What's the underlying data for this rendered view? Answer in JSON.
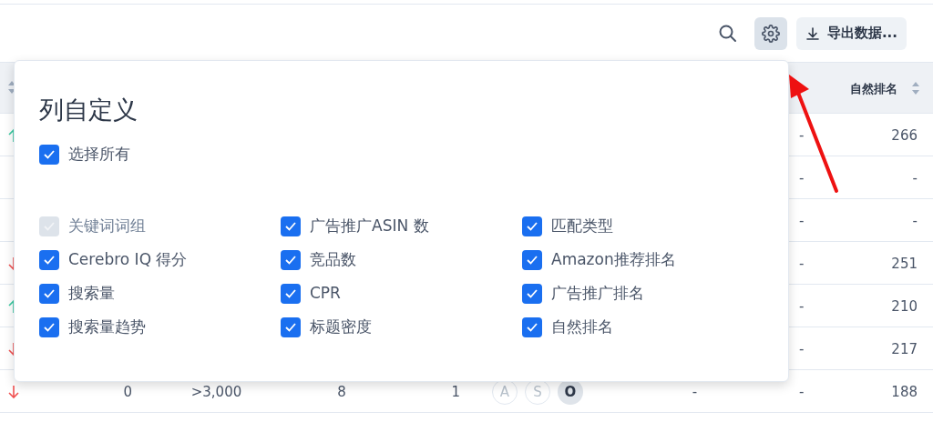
{
  "toolbar": {
    "export_button": "导出数据..."
  },
  "table": {
    "header": {
      "natural_rank": "自然排名"
    },
    "rows": [
      {
        "kind": "up",
        "column_8": "-",
        "natural_rank": "266"
      },
      {
        "column_8": "-",
        "natural_rank": "-"
      },
      {
        "column_8": "-",
        "natural_rank": "-"
      },
      {
        "kind": "down",
        "column_8": "-",
        "natural_rank": "251"
      },
      {
        "kind": "up",
        "column_8": "-",
        "natural_rank": "210"
      },
      {
        "kind": "down",
        "column_8": "-",
        "natural_rank": "217"
      },
      {
        "kind": "down",
        "column_2": "0",
        "column_3": ">3,000",
        "column_4": "8",
        "column_5": "1",
        "badges": [
          {
            "label": "A",
            "selected": false
          },
          {
            "label": "S",
            "selected": false
          },
          {
            "label": "O",
            "selected": true
          }
        ],
        "column_7": "-",
        "column_8": "-",
        "natural_rank": "188"
      }
    ]
  },
  "popup": {
    "title": "列自定义",
    "select_all": {
      "label": "选择所有",
      "checked": true,
      "disabled": false
    },
    "columns": [
      [
        {
          "label": "关键词词组",
          "checked": true,
          "disabled": true
        },
        {
          "label": "Cerebro IQ 得分",
          "checked": true,
          "disabled": false
        },
        {
          "label": "搜索量",
          "checked": true,
          "disabled": false
        },
        {
          "label": "搜索量趋势",
          "checked": true,
          "disabled": false
        }
      ],
      [
        {
          "label": "广告推广ASIN 数",
          "checked": true,
          "disabled": false
        },
        {
          "label": "竞品数",
          "checked": true,
          "disabled": false
        },
        {
          "label": "CPR",
          "checked": true,
          "disabled": false
        },
        {
          "label": "标题密度",
          "checked": true,
          "disabled": false
        }
      ],
      [
        {
          "label": "匹配类型",
          "checked": true,
          "disabled": false
        },
        {
          "label": "Amazon推荐排名",
          "checked": true,
          "disabled": false
        },
        {
          "label": "广告推广排名",
          "checked": true,
          "disabled": false
        },
        {
          "label": "自然排名",
          "checked": true,
          "disabled": false
        }
      ]
    ]
  }
}
